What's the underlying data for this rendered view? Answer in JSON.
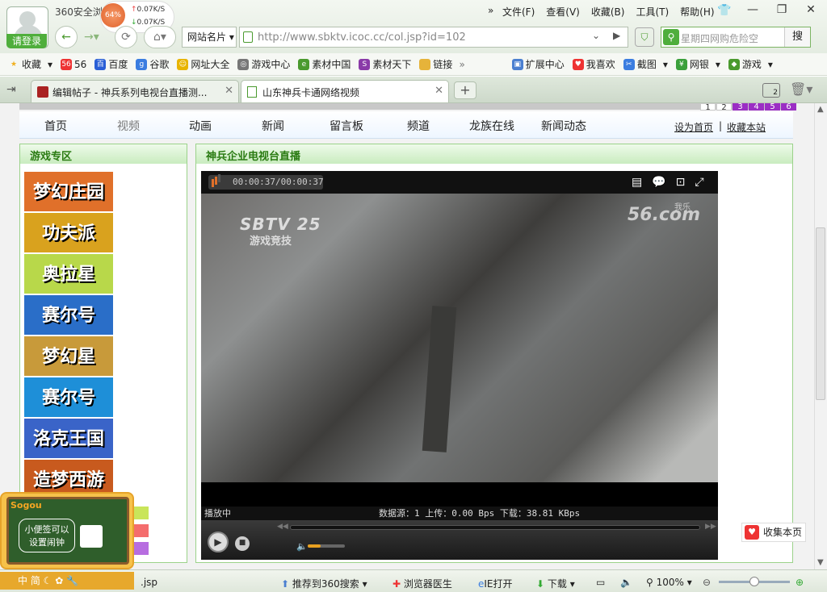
{
  "app": {
    "name": "360安全浏",
    "login": "请登录",
    "speed_pct": "64%",
    "up": "0.07K/S",
    "down": "0.07K/S"
  },
  "menu": [
    "文件(F)",
    "查看(V)",
    "收藏(B)",
    "工具(T)",
    "帮助(H)"
  ],
  "nav": {
    "addr_tag": "网站名片",
    "url": "http://www.sbktv.icoc.cc/col.jsp?id=102",
    "search_placeholder": "星期四网购危险空",
    "search_btn": "搜"
  },
  "bookmarks": [
    {
      "label": "收藏",
      "icon": "star-icon",
      "color": "#f0b020"
    },
    {
      "label": "56",
      "icon": "56-icon",
      "color": "#e33"
    },
    {
      "label": "百度",
      "icon": "baidu-icon",
      "color": "#2a5fd6"
    },
    {
      "label": "谷歌",
      "icon": "google-icon",
      "color": "#3b7de0"
    },
    {
      "label": "网址大全",
      "icon": "smile-icon",
      "color": "#e8b400"
    },
    {
      "label": "游戏中心",
      "icon": "gamepad-icon",
      "color": "#777"
    },
    {
      "label": "素材中国",
      "icon": "page-icon",
      "color": "#4a9a2e"
    },
    {
      "label": "素材天下",
      "icon": "s-icon",
      "color": "#8a3aa8"
    },
    {
      "label": "链接",
      "icon": "folder-icon",
      "color": "#e6b33a"
    }
  ],
  "bookmarks_right": [
    {
      "label": "扩展中心",
      "icon": "cube-icon",
      "color": "#4a7fd0"
    },
    {
      "label": "我喜欢",
      "icon": "heart-icon",
      "color": "#e33"
    },
    {
      "label": "截图",
      "icon": "crop-icon",
      "color": "#3b7de0"
    },
    {
      "label": "网银",
      "icon": "bank-icon",
      "color": "#3ba03b"
    },
    {
      "label": "游戏",
      "icon": "game-icon",
      "color": "#4a9a2e"
    }
  ],
  "tabs": [
    {
      "label": "编辑帖子 - 神兵系列电视台直播测..."
    },
    {
      "label": "山东神兵卡通网络视频"
    }
  ],
  "tab_count": "2",
  "pages": [
    "1",
    "2",
    "3",
    "4",
    "5",
    "6"
  ],
  "site_nav": [
    "首页",
    "视频",
    "动画",
    "新闻",
    "留言板",
    "频道",
    "龙族在线",
    "新闻动态"
  ],
  "site_links": {
    "home": "设为首页",
    "sep": "|",
    "fav": "收藏本站"
  },
  "left_panel": {
    "title": "游戏专区",
    "games": [
      {
        "name": "梦幻庄园",
        "color": "#e0702a"
      },
      {
        "name": "功夫派",
        "color": "#d9a21e"
      },
      {
        "name": "奥拉星",
        "color": "#b8d84a"
      },
      {
        "name": "赛尔号",
        "color": "#2a6ec8"
      },
      {
        "name": "梦幻星",
        "color": "#c89a3a"
      },
      {
        "name": "赛尔号",
        "color": "#1e8fd8"
      },
      {
        "name": "洛克王国",
        "color": "#3a64c8"
      },
      {
        "name": "造梦西游",
        "color": "#c85a1e"
      }
    ]
  },
  "right_panel": {
    "title": "神兵企业电视台直播"
  },
  "player": {
    "time": "00:00:37/00:00:37",
    "logo_left": "SBTV",
    "logo_num": "25",
    "logo_sub": "游戏竞技",
    "logo_right": "56.com",
    "logo_right_sub": "我乐",
    "status": "播放中",
    "stats": "数据源：1 上传：0.00 Bps 下载：38.81 KBps"
  },
  "sticky": {
    "text": "小便签可以设置闹钟",
    "brand": "Sogou"
  },
  "collect": "收集本页",
  "statusbar": {
    "ime": "中 简",
    "file": ".jsp",
    "recommend": "推荐到360搜索",
    "doctor": "浏览器医生",
    "ie": "IE打开",
    "download": "下载",
    "zoom": "100%"
  }
}
